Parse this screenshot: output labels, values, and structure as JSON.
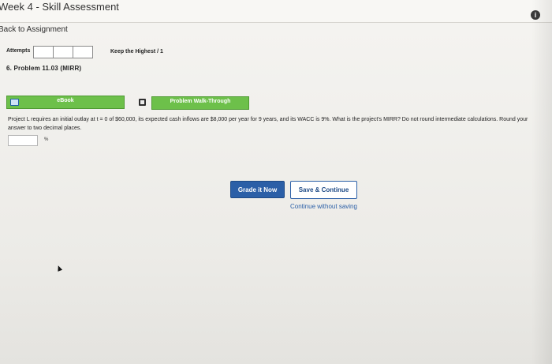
{
  "window": {
    "title": "Week 4 - Skill Assessment"
  },
  "header": {
    "info_icon_glyph": "i",
    "back_link": "Back to Assignment"
  },
  "attempts": {
    "label": "Attempts",
    "keep_highest": "Keep the Highest / 1"
  },
  "problem": {
    "title": "6. Problem 11.03 (MIRR)",
    "ebook_label": "eBook",
    "walkthrough_label": "Problem Walk-Through",
    "question": "Project L requires an initial outlay at t = 0 of $60,000, its expected cash inflows are $8,000 per year for 9 years, and its WACC is 9%. What is the project's MIRR? Do not round intermediate calculations. Round your answer to two decimal places.",
    "answer_value": "",
    "answer_unit": "%"
  },
  "actions": {
    "grade_label": "Grade it Now",
    "save_label": "Save & Continue",
    "continue_label": "Continue without saving"
  },
  "colors": {
    "accent_green": "#6dc04a",
    "primary_blue": "#2b5fa7"
  }
}
